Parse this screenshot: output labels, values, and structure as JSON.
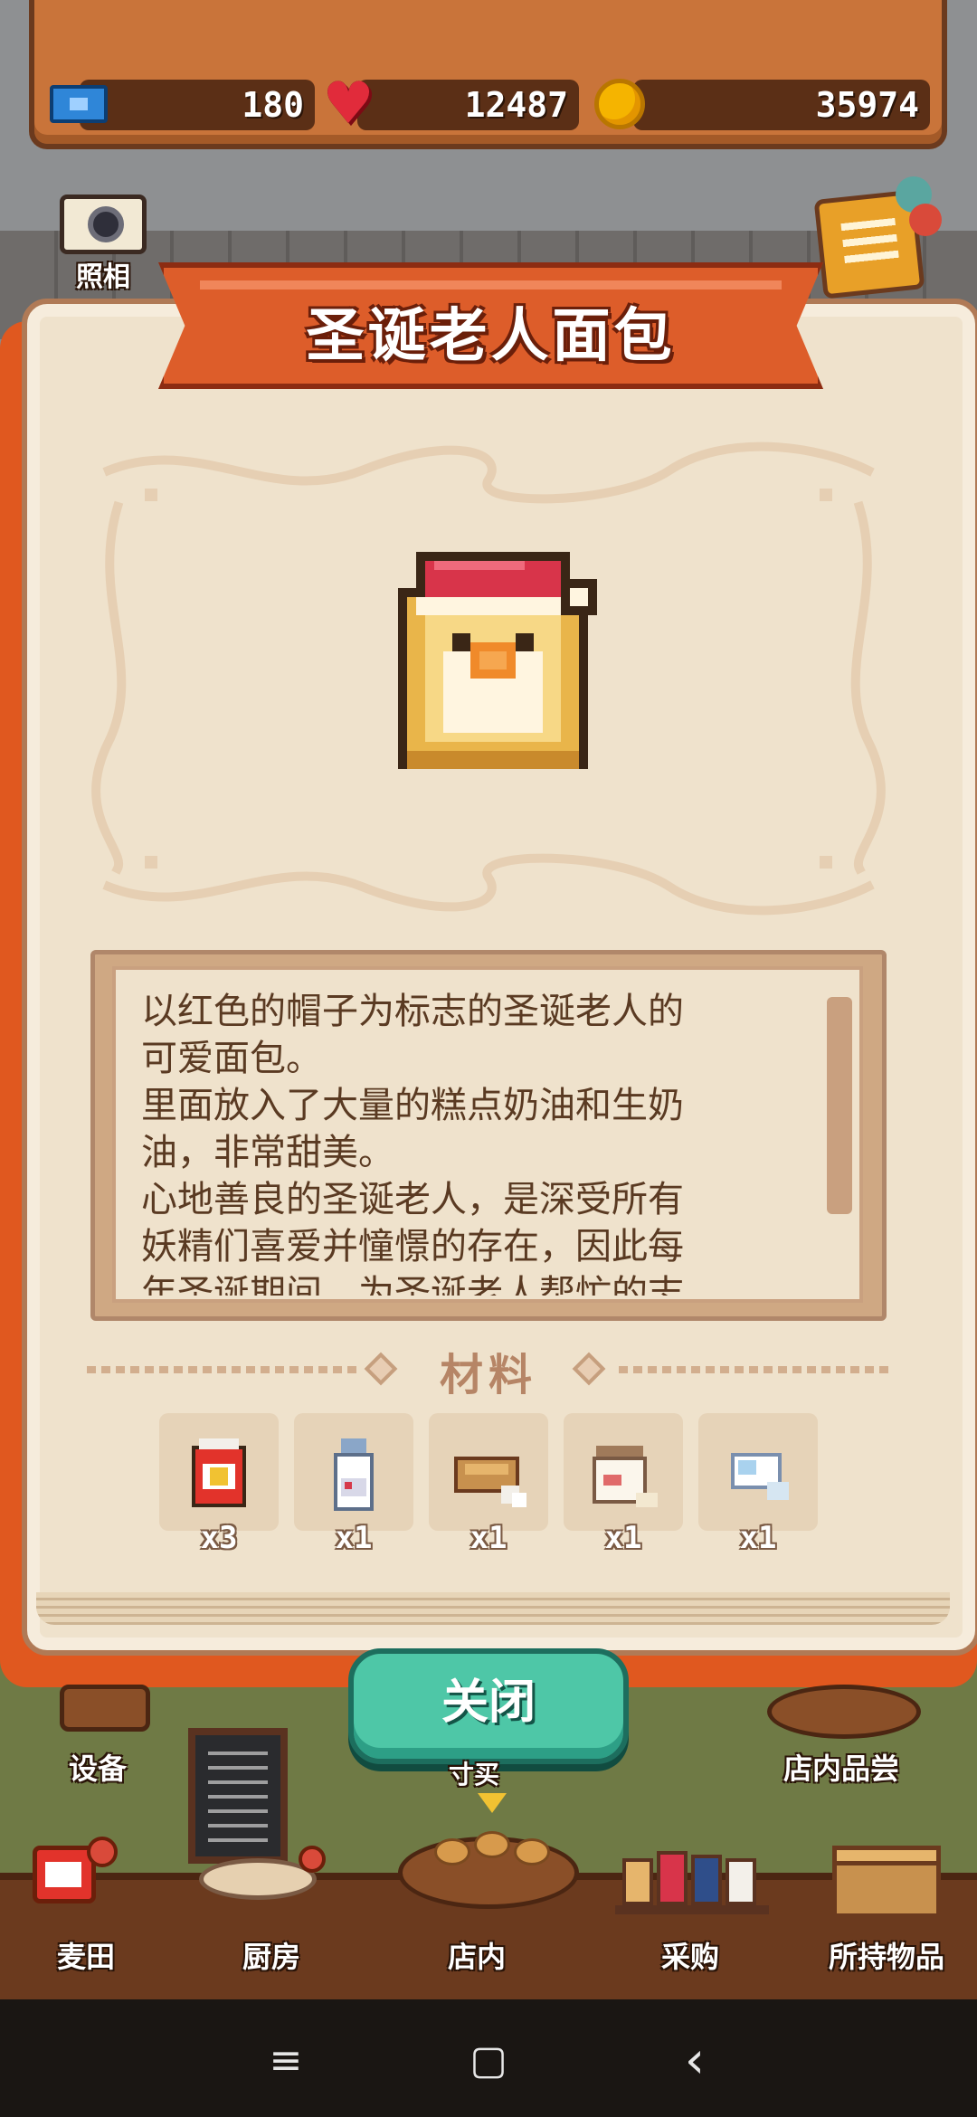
{
  "resources": {
    "tickets": "180",
    "hearts": "12487",
    "coins": "35974"
  },
  "side_buttons": {
    "camera_label": "照相"
  },
  "dialog": {
    "title": "圣诞老人面包",
    "description": "以红色的帽子为标志的圣诞老人的\n可爱面包。\n里面放入了大量的糕点奶油和生奶\n油，非常甜美。\n心地善良的圣诞老人，是深受所有\n妖精们喜爱并憧憬的存在，因此每\n年圣诞期间，为圣诞老人帮忙的志",
    "materials_title": "材料",
    "materials": [
      {
        "icon": "flour-bag-icon",
        "qty": "x3"
      },
      {
        "icon": "milk-bottle-icon",
        "qty": "x1"
      },
      {
        "icon": "bread-dough-icon",
        "qty": "x1"
      },
      {
        "icon": "sugar-jar-icon",
        "qty": "x1"
      },
      {
        "icon": "cream-icon",
        "qty": "x1"
      }
    ],
    "close_label": "关闭"
  },
  "scene": {
    "equipment_label": "设备",
    "tasting_label": "店内品尝",
    "partial_label": "寸买"
  },
  "bottom_nav": [
    {
      "label": "麦田",
      "icon": "wheat-field-icon"
    },
    {
      "label": "厨房",
      "icon": "kitchen-icon"
    },
    {
      "label": "店内",
      "icon": "store-icon"
    },
    {
      "label": "采购",
      "icon": "purchase-icon"
    },
    {
      "label": "所持物品",
      "icon": "inventory-box-icon"
    }
  ],
  "system_nav": {
    "menu": "≡",
    "home": "▢",
    "back": "‹"
  },
  "colors": {
    "banner": "#dd5d2a",
    "close_button": "#4ec7a7",
    "page": "#efe2cc",
    "text": "#5a3a22"
  }
}
